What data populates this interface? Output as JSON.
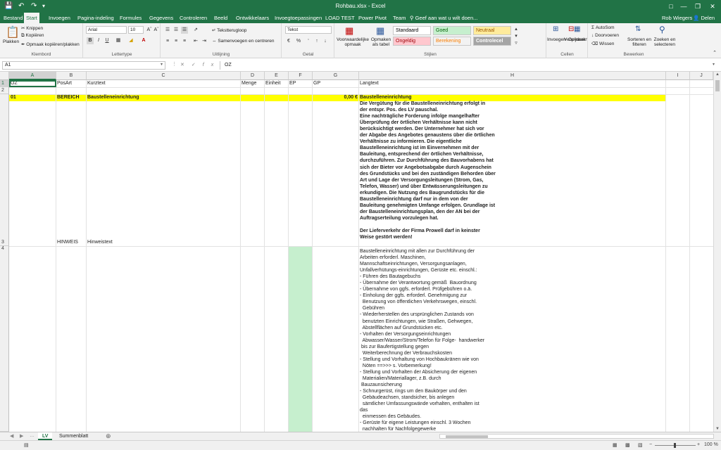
{
  "app": {
    "window_title": "Rohbau.xlsx - Excel",
    "user": "Rob Wiegers",
    "share_label": "Delen",
    "tell_me": "Geef aan wat u wilt doen..."
  },
  "tabs": [
    "Bestand",
    "Start",
    "Invoegen",
    "Pagina-indeling",
    "Formules",
    "Gegevens",
    "Controleren",
    "Beeld",
    "Ontwikkelaars",
    "Invoegtoepassingen",
    "LOAD TEST",
    "Power Pivot",
    "Team"
  ],
  "active_tab": "Start",
  "ribbon": {
    "clipboard": {
      "paste": "Plakken",
      "cut": "Knippen",
      "copy": "Kopiëren",
      "format_painter": "Opmaak kopiëren/plakken",
      "group": "Klembord"
    },
    "font": {
      "name": "Arial",
      "size": "10",
      "group": "Lettertype"
    },
    "alignment": {
      "wrap": "Tekstterugloop",
      "merge": "Samenvoegen en centreren",
      "group": "Uitlijning"
    },
    "number": {
      "format": "Tekst",
      "group": "Getal"
    },
    "styles": {
      "conditional": "Voorwaardelijke opmaak",
      "as_table": "Opmaken als tabel",
      "group": "Stijlen",
      "cells": [
        {
          "label": "Standaard",
          "bg": "#ffffff",
          "fg": "#000000"
        },
        {
          "label": "Goed",
          "bg": "#c6efce",
          "fg": "#006100"
        },
        {
          "label": "Neutraal",
          "bg": "#ffeb9c",
          "fg": "#9c5700"
        },
        {
          "label": "Ongeldig",
          "bg": "#ffc7ce",
          "fg": "#9c0006"
        },
        {
          "label": "Berekening",
          "bg": "#f2f2f2",
          "fg": "#fa7d00"
        },
        {
          "label": "Controlecel",
          "bg": "#a5a5a5",
          "fg": "#ffffff"
        }
      ]
    },
    "cells": {
      "insert": "Invoegen",
      "delete": "Verwijderen",
      "format": "Opmaak",
      "group": "Cellen"
    },
    "editing": {
      "autosum": "AutoSom",
      "fill": "Doorvoeren",
      "clear": "Wissen",
      "sort": "Sorteren en filteren",
      "find": "Zoeken en selecteren",
      "group": "Bewerken"
    }
  },
  "formula_bar": {
    "name_box": "A1",
    "value": "OZ"
  },
  "columns": [
    "A",
    "B",
    "C",
    "D",
    "E",
    "F",
    "G",
    "H",
    "I",
    "J"
  ],
  "rows": [
    "1",
    "2",
    "3",
    "4"
  ],
  "headers": {
    "A": "OZ",
    "B": "PosArt",
    "C": "Kurztext",
    "D": "Menge",
    "E": "Einheit",
    "F": "EP",
    "G": "GP",
    "H": "Langtext"
  },
  "row3": {
    "oz": "01",
    "posart": "BEREICH",
    "kurztext": "Baustelleneinrichtung",
    "gp": "0,00 €",
    "langtext": "Baustelleneinrichtung\nDie Vergütung für die Baustelleneinrichtung erfolgt in\nder entspr. Pos. des LV pauschal.\nEine nachträgliche Forderung infolge mangelhafter\nÜberprüfung der örtlichen Verhältnisse kann nicht\nberücksichtigt werden. Der Unternehmer hat sich vor\nder Abgabe des Angebotes genaustens über die örtlichen\nVerhältnisse zu informieren. Die eigentliche\nBaustelleneinrichtung ist im Einvernehmen mit der\nBauleitung, entsprechend der örtlichen Verhältnisse,\ndurchzuführen. Zur Durchführung des Bauvorhabens hat\nsich der Bieter vor Angebotsabgabe durch Augenschein\ndes Grundstücks und bei den zuständigen Behorden über\nArt und Lage der Versorgungsleitungen (Strom, Gas,\nTelefon, Wasser) und über Entwässerungsleitungen zu\nerkundigen. Die Nutzung des Baugrundstücks für die\nBaustelleneinrichtung darf nur in dem von der\nBauleitung genehmigten Umfange erfolgen. Grundlage ist\nder Baustelleneinrichtungsplan, den der AN bei der\nAuftragserteilung vorzulegen hat.\n\nDer Lieferverkehr der Firma Prowell darf in keinster\nWeise gestört werden!"
  },
  "row4": {
    "posart": "HINWEIS",
    "kurztext": "Hinweistext",
    "langtext": "Baustelleneinrichtung mit allen zur Durchführung der\nArbeiten erforderl. Maschinen,\nMannschaftseinrichtungen, Versorgungsanlagen,\nUnfallverhütungs-einrichtungen, Gerüste etc. einschl.:\n- Führen des Bautagebuchs\n- Übernahme der Verantwortung gemäß  Bauordnung\n- Übernahme von ggfs. erforderl. Prüfgebühren o.ä.\n- Einholung der ggfs. erforderl. Genehmigung zur\n  Benutzung von öffentlichen Verkehrswegen, einschl.\n  Gebühren\n- Wiederherstellen des ursprünglichen Zustands von\n  benutzten Einrichtungen, wie Straßen, Gehwegen,\n  Abstellflächen auf Grundstücken etc.\n- Vorhalten der Versorgungseinrichtungen\n  Abwasser/Wasser/Strom/Telefon für Folge-  handwerker\n bis zur Baufertigstellung gegen\n  Weiterberechnung der Verbrauchskosten\n- Stellung und Vorhaltung von Hochbaukränen wie von\n  Nöten ==>>> s. Vorbemerkung!\n- Stellung und Vorhalten der Absicherung der eigenen\n  Materialien/Materiallager, z.B. durch\n Bauzaunsicherung\n- Schnurgerüst, rings um den Baukörper und den\n  Gebäudeachsen, standsicher, bis anlegen\n  sämtlicher Umfassungswände vorhalten, enthalten ist\ndas\n  einmessen des Gebäudes.\n- Gerüste für eigene Leistungen einschl. 3 Wochen\n  nachhalten für Nachfolgegewerke"
  },
  "sheets": [
    "LV",
    "Summenblatt"
  ],
  "active_sheet": "LV",
  "status": {
    "zoom": "100 %"
  },
  "colors": {
    "excel_green": "#217346",
    "highlight_yellow": "#ffff00",
    "ep_green": "#c6efce"
  }
}
